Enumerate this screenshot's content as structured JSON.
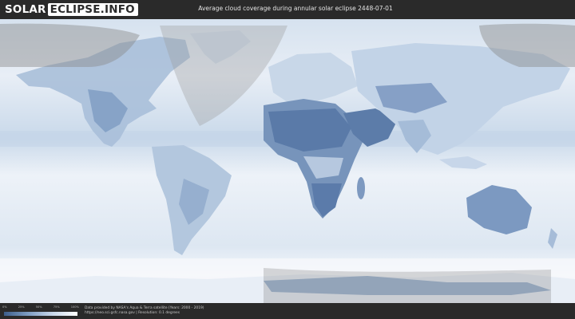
{
  "header": {
    "logo_solar": "SOLAR",
    "logo_eclipse": "ECLIPSE.INFO",
    "title": "Average cloud coverage during annular solar eclipse 2448-07-01"
  },
  "legend": {
    "labels": [
      "0%",
      "25%",
      "50%",
      "75%",
      "100%"
    ],
    "colors": {
      "clear": "#3d5f8c",
      "overcast": "#ffffff"
    }
  },
  "footer": {
    "credit_line1": "Data provided by NASA's Aqua & Terra satellite (Years: 2000 - 2019)",
    "credit_line2": "https://neo.sci.gsfc.nasa.gov | Resolution: 0.1 degrees"
  },
  "colors": {
    "ocean_cloudy": "#dfe9f4",
    "land_clear": "#5d7fae",
    "shadow_band": "#9a9a9a"
  }
}
